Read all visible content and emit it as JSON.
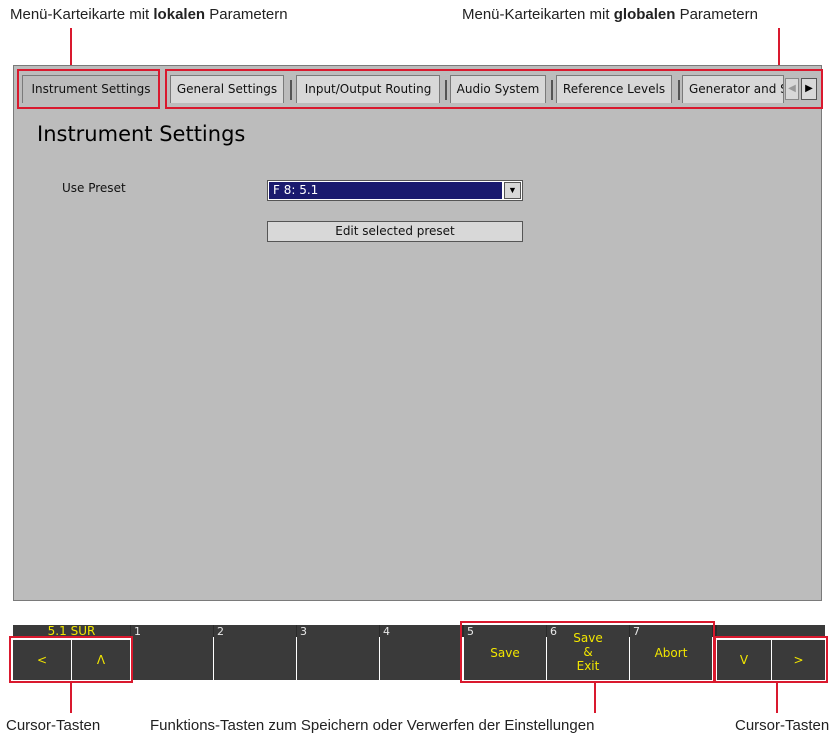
{
  "annotations": {
    "local_tab_caption_prefix": "Menü-Karteikarte mit ",
    "local_tab_caption_bold": "lokalen",
    "local_tab_caption_suffix": " Parametern",
    "global_tabs_caption_prefix": "Menü-Karteikarten mit ",
    "global_tabs_caption_bold": "globalen",
    "global_tabs_caption_suffix": " Parametern",
    "cursor_left_caption": "Cursor-Tasten",
    "function_keys_caption": "Funktions-Tasten zum Speichern oder Verwerfen der Einstellungen",
    "cursor_right_caption": "Cursor-Tasten"
  },
  "tabs": {
    "local": "Instrument Settings",
    "global": [
      "General Settings",
      "Input/Output Routing",
      "Audio System",
      "Reference Levels",
      "Generator and S"
    ]
  },
  "main": {
    "title": "Instrument Settings",
    "use_preset_label": "Use Preset",
    "preset_value": "F 8: 5.1",
    "edit_button": "Edit selected preset"
  },
  "bottom": {
    "status_label": "5.1 SUR",
    "left_keys": [
      "<",
      "Λ"
    ],
    "numbered_keys": [
      "1",
      "2",
      "3",
      "4"
    ],
    "function_keys": [
      {
        "num": "5",
        "label": "Save"
      },
      {
        "num": "6",
        "label_l1": "Save",
        "label_l2": "&",
        "label_l3": "Exit"
      },
      {
        "num": "7",
        "label": "Abort"
      }
    ],
    "right_keys": [
      "V",
      ">"
    ]
  },
  "colors": {
    "highlight_red": "#d9192e",
    "panel_gray": "#bcbcbc",
    "key_dark": "#3a3a3a",
    "key_label_yellow": "#f2e600",
    "dropdown_navy": "#1a1a6e"
  }
}
